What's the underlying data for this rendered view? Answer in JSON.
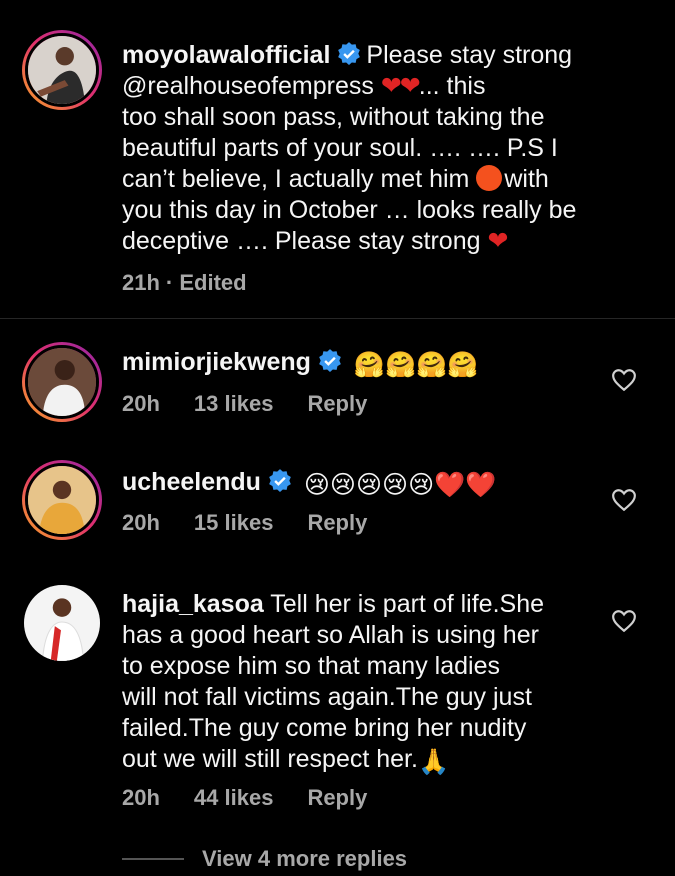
{
  "comments": [
    {
      "username": "moyolawalofficial",
      "verified": true,
      "text_before_mention": "Please stay strong",
      "mention": "@realhouseofempress",
      "text_lines": [
        "... this",
        "too shall soon pass, without taking the",
        "beautiful parts of your soul. …. …. P.S I",
        "can’t believe, I actually met him",
        "with",
        "you this day in October … looks really be",
        "deceptive …. Please stay strong"
      ],
      "time": "21h",
      "edited": "· Edited"
    },
    {
      "username": "mimiorjiekweng",
      "verified": true,
      "emoji_text": "🤗🤗🤗🤗",
      "time": "20h",
      "likes": "13 likes",
      "reply": "Reply"
    },
    {
      "username": "ucheelendu",
      "verified": true,
      "emoji_text": "😢😢😢😢😢❤️❤️",
      "time": "20h",
      "likes": "15 likes",
      "reply": "Reply"
    },
    {
      "username": "hajia_kasoa",
      "verified": false,
      "text_lines": [
        "Tell her is part of life.She",
        "has a good heart so Allah is using her",
        "to expose him so that many ladies",
        "will not fall victims again.The guy just",
        "failed.The guy come bring her nudity",
        "out we will still respect her."
      ],
      "time": "20h",
      "likes": "44 likes",
      "reply": "Reply"
    }
  ],
  "view_more": "View 4 more replies",
  "colors": {
    "background": "#000000",
    "text": "#f5f5f5",
    "meta": "#a8a8a8",
    "verified": "#3897f0",
    "heart": "#e02424"
  }
}
